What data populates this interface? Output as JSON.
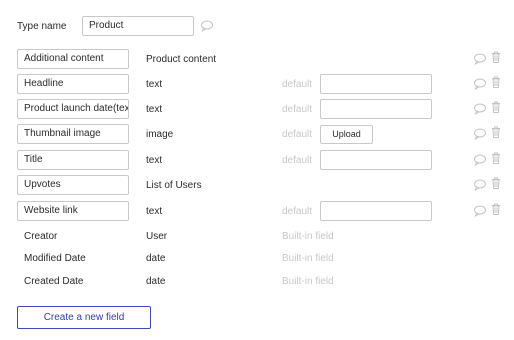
{
  "type_name": {
    "label": "Type name",
    "value": "Product"
  },
  "default_label": "default",
  "upload_label": "Upload",
  "builtin_label": "Built-in field",
  "fields": [
    {
      "name": "Additional content",
      "type": "Product content"
    },
    {
      "name": "Headline",
      "type": "text"
    },
    {
      "name": "Product launch date(tex",
      "type": "text"
    },
    {
      "name": "Thumbnail image",
      "type": "image"
    },
    {
      "name": "Title",
      "type": "text"
    },
    {
      "name": "Upvotes",
      "type": "List of Users"
    },
    {
      "name": "Website link",
      "type": "text"
    }
  ],
  "builtin_fields": [
    {
      "name": "Creator",
      "type": "User"
    },
    {
      "name": "Modified Date",
      "type": "date"
    },
    {
      "name": "Created Date",
      "type": "date"
    }
  ],
  "create_button": "Create a new field",
  "icons": {
    "comment": "comment-icon",
    "delete": "trash-icon",
    "color": "#c4c4c4"
  }
}
